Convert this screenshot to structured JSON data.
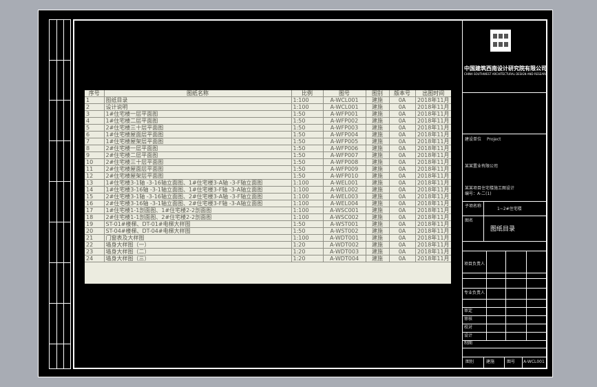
{
  "table": {
    "headers": [
      "序号",
      "图纸名称",
      "比例",
      "图号",
      "图别",
      "版本号",
      "出图时间"
    ],
    "rows": [
      [
        "1",
        "图纸目录",
        "1:100",
        "A-WCL001",
        "建施",
        "0A",
        "2018年11月"
      ],
      [
        "2",
        "设计说明",
        "1:100",
        "A-WCL001",
        "建施",
        "0A",
        "2018年11月"
      ],
      [
        "3",
        "1#住宅楼一层平面图",
        "1:50",
        "A-WFP001",
        "建施",
        "0A",
        "2018年11月"
      ],
      [
        "4",
        "1#住宅楼二层平面图",
        "1:50",
        "A-WFP002",
        "建施",
        "0A",
        "2018年11月"
      ],
      [
        "5",
        "2#住宅楼三十层平面图",
        "1:50",
        "A-WFP003",
        "建施",
        "0A",
        "2018年11月"
      ],
      [
        "6",
        "1#住宅楼屋面层平面图",
        "1:50",
        "A-WFP004",
        "建施",
        "0A",
        "2018年11月"
      ],
      [
        "7",
        "1#住宅楼屋架层平面图",
        "1:50",
        "A-WFP005",
        "建施",
        "0A",
        "2018年11月"
      ],
      [
        "8",
        "2#住宅楼一层平面图",
        "1:50",
        "A-WFP006",
        "建施",
        "0A",
        "2018年11月"
      ],
      [
        "9",
        "2#住宅楼二层平面图",
        "1:50",
        "A-WFP007",
        "建施",
        "0A",
        "2018年11月"
      ],
      [
        "10",
        "2#住宅楼三十层平面图",
        "1:50",
        "A-WFP008",
        "建施",
        "0A",
        "2018年11月"
      ],
      [
        "11",
        "2#住宅楼屋面层平面图",
        "1:50",
        "A-WFP009",
        "建施",
        "0A",
        "2018年11月"
      ],
      [
        "12",
        "2#住宅楼屋架层平面图",
        "1:50",
        "A-WFP010",
        "建施",
        "0A",
        "2018年11月"
      ],
      [
        "13",
        "1#住宅楼3-1轴 -3-16轴立面图、1#住宅楼3-A轴 -3-F轴立面图",
        "1:100",
        "A-WEL001",
        "建施",
        "0A",
        "2018年11月"
      ],
      [
        "14",
        "1#住宅楼3-16轴 -3-1轴立面图、1#住宅楼3-F轴 -3-A轴立面图",
        "1:100",
        "A-WEL002",
        "建施",
        "0A",
        "2018年11月"
      ],
      [
        "15",
        "2#住宅楼3-1轴 -3-16轴立面图、2#住宅楼3-A轴 -3-F轴立面图",
        "1:100",
        "A-WEL003",
        "建施",
        "0A",
        "2018年11月"
      ],
      [
        "16",
        "2#住宅楼3-16轴 -3-1轴立面图、2#住宅楼3-F轴 -3-A轴立面图",
        "1:100",
        "A-WEL004",
        "建施",
        "0A",
        "2018年11月"
      ],
      [
        "17",
        "1#住宅楼1-1剖面图、1#住宅楼2-2剖面图",
        "1:100",
        "A-WSC001",
        "建施",
        "0A",
        "2018年11月"
      ],
      [
        "18",
        "2#住宅楼1-1剖面图、2#住宅楼2-2剖面图",
        "1:100",
        "A-WSC002",
        "建施",
        "0A",
        "2018年11月"
      ],
      [
        "19",
        "ST-01#楼梯、DT-01#电梯大样图",
        "1:50",
        "A-WST001",
        "建施",
        "0A",
        "2018年11月"
      ],
      [
        "20",
        "ST-04#楼梯、DT-04#电梯大样图",
        "1:50",
        "A-WST002",
        "建施",
        "0A",
        "2018年11月"
      ],
      [
        "21",
        "门窗表及大样图",
        "1:100",
        "A-WDT001",
        "建施",
        "0A",
        "2018年11月"
      ],
      [
        "22",
        "墙身大样图（一）",
        "1:20",
        "A-WDT002",
        "建施",
        "0A",
        "2018年11月"
      ],
      [
        "23",
        "墙身大样图（二）",
        "1:20",
        "A-WDT003",
        "建施",
        "0A",
        "2018年11月"
      ],
      [
        "24",
        "墙身大样图（三）",
        "1:20",
        "A-WDT004",
        "建施",
        "0A",
        "2018年11月"
      ]
    ]
  },
  "title_block": {
    "company": "中国建筑西南设计研究院有限公司",
    "company_en": "CHINA SOUTHWEST ARCHITECTURAL DESIGN AND RESEARCH INSTITUTE CORP. LTD",
    "project_label": "建设单位",
    "project_value": "Project",
    "developer": "某某置业有限公司",
    "note_line1": "某某项目住宅楼施工图设计",
    "note_line2": "编号：A-二(1)",
    "sub_label": "子项名称",
    "sub_value": "1~2#住宅楼",
    "drawing_label": "图名",
    "drawing_title": "图纸目录",
    "row_labels": [
      "项目负责人",
      "专业负责人",
      "审定",
      "审核",
      "校对",
      "设计",
      "制图"
    ],
    "footer_labels": [
      "图别",
      "建施",
      "图号",
      "A-WCL001"
    ]
  }
}
